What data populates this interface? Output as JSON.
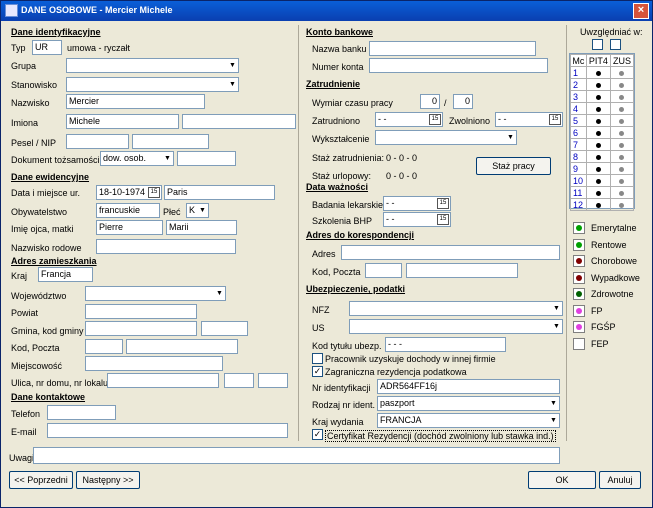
{
  "window": {
    "title": "DANE OSOBOWE - Mercier Michele"
  },
  "sections": {
    "personal": "Dane identyfikacyjne",
    "records": "Dane ewidencyjne",
    "residence": "Adres zamieszkania",
    "contact": "Dane kontaktowe",
    "bank": "Konto bankowe",
    "employment": "Zatrudnienie",
    "validity": "Data ważności",
    "correspondence": "Adres do korespondencji",
    "insurance": "Ubezpieczenie, podatki"
  },
  "personal": {
    "typ_label": "Typ",
    "typ_value": "UR",
    "typ_desc": "umowa - ryczałt",
    "grupa_label": "Grupa",
    "grupa_value": "",
    "stanowisko_label": "Stanowisko",
    "stanowisko_value": "",
    "nazwisko_label": "Nazwisko",
    "nazwisko_value": "Mercier",
    "imiona_label": "Imiona",
    "imie1": "Michele",
    "imie2": "",
    "pesel_label": "Pesel / NIP",
    "pesel": "",
    "nip": "",
    "dok_label": "Dokument tożsamości",
    "dok_type": "dow. osob.",
    "dok_num": ""
  },
  "records": {
    "birth_label": "Data i miejsce ur.",
    "birth_date": "18-10-1974",
    "birth_place": "Paris",
    "obyw_label": "Obywatelstwo",
    "obyw_value": "francuskie",
    "plec_label": "Płeć",
    "plec_value": "K",
    "parents_label": "Imię ojca, matki",
    "father": "Pierre",
    "mother": "Marii",
    "rodowe_label": "Nazwisko rodowe",
    "rodowe_value": ""
  },
  "residence": {
    "kraj_label": "Kraj",
    "kraj_value": "Francja",
    "woj_label": "Województwo",
    "powiat_label": "Powiat",
    "gmina_label": "Gmina, kod gminy",
    "kod_label": "Kod, Poczta",
    "miejsc_label": "Miejscowość",
    "ulica_label": "Ulica, nr domu, nr lokalu"
  },
  "contact": {
    "tel_label": "Telefon",
    "email_label": "E-mail"
  },
  "bank": {
    "nazwa_label": "Nazwa banku",
    "numer_label": "Numer konta"
  },
  "employment": {
    "wymiar_label": "Wymiar czasu pracy",
    "wymiar_num": "0",
    "wymiar_sep": "/",
    "wymiar_den": "0",
    "zatr_label": "Zatrudniono",
    "zatr_value": "- -",
    "zwol_label": "Zwolniono",
    "zwol_value": "- -",
    "wyksz_label": "Wykształcenie",
    "staz_zatr_label": "Staż zatrudnienia:",
    "staz_zatr_value": "0 - 0 - 0",
    "staz_url_label": "Staż urlopowy:",
    "staz_url_value": "0 - 0 - 0",
    "staz_button": "Staż pracy"
  },
  "validity": {
    "bad_label": "Badania lekarskie",
    "bad_value": "- -",
    "bhp_label": "Szkolenia BHP",
    "bhp_value": "- -"
  },
  "correspondence": {
    "adres_label": "Adres",
    "kod_label": "Kod, Poczta"
  },
  "insurance": {
    "nfz_label": "NFZ",
    "us_label": "US",
    "kod_tyt_label": "Kod tytułu ubezp.",
    "kod_tyt_value": "- - -",
    "chk_innej": "Pracownik uzyskuje dochody w innej firmie",
    "chk_zagr": "Zagraniczna rezydencja podatkowa",
    "nr_ident_label": "Nr identyfikacji",
    "nr_ident_value": "ADR564FF16j",
    "rodzaj_label": "Rodzaj nr ident.",
    "rodzaj_value": "paszport",
    "kraj_wyd_label": "Kraj wydania",
    "kraj_wyd_value": "FRANCJA",
    "chk_cert": "Certyfikat Rezydencji (dochód zwolniony lub stawka ind.)"
  },
  "uwagi_label": "Uwagi",
  "right_panel": {
    "uwzgl_label": "Uwzględniać w:",
    "headers": [
      "Mc",
      "PIT4",
      "ZUS"
    ],
    "months": [
      "1",
      "2",
      "3",
      "4",
      "5",
      "6",
      "7",
      "8",
      "9",
      "10",
      "11",
      "12"
    ],
    "legend": [
      {
        "label": "Emerytalne",
        "color": "#00a000"
      },
      {
        "label": "Rentowe",
        "color": "#00a000"
      },
      {
        "label": "Chorobowe",
        "color": "#800000"
      },
      {
        "label": "Wypadkowe",
        "color": "#800000"
      },
      {
        "label": "Zdrowotne",
        "color": "#006000"
      },
      {
        "label": "FP",
        "color": "#e040e0"
      },
      {
        "label": "FGŚP",
        "color": "#e040e0"
      },
      {
        "label": "FEP",
        "color": ""
      }
    ]
  },
  "buttons": {
    "prev": "<< Poprzedni",
    "next": "Następny >>",
    "ok": "OK",
    "cancel": "Anuluj"
  }
}
